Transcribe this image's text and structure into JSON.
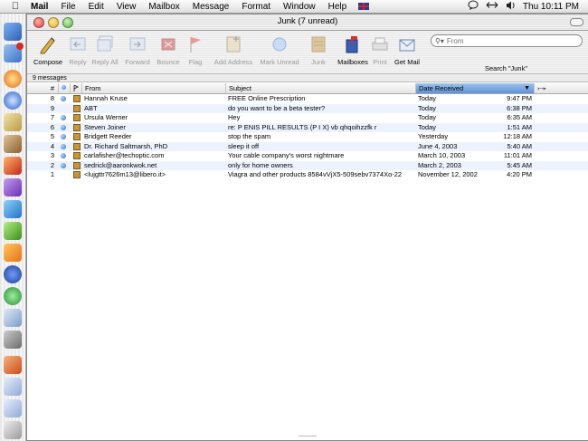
{
  "menubar": {
    "app_name": "Mail",
    "menus": [
      "File",
      "Edit",
      "View",
      "Mailbox",
      "Message",
      "Format",
      "Window",
      "Help"
    ],
    "clock": "Thu 10:11 PM"
  },
  "window": {
    "title": "Junk (7 unread)"
  },
  "toolbar": {
    "buttons": [
      {
        "label": "Compose",
        "enabled": true,
        "icon": "compose-icon"
      },
      {
        "label": "Reply",
        "enabled": false,
        "icon": "reply-icon"
      },
      {
        "label": "Reply All",
        "enabled": false,
        "icon": "reply-all-icon"
      },
      {
        "label": "Forward",
        "enabled": false,
        "icon": "forward-icon"
      },
      {
        "label": "Bounce",
        "enabled": false,
        "icon": "bounce-icon"
      },
      {
        "label": "Flag",
        "enabled": false,
        "icon": "flag-icon"
      },
      {
        "label": "Add Address",
        "enabled": false,
        "icon": "add-address-icon"
      },
      {
        "label": "Mark Unread",
        "enabled": false,
        "icon": "mark-unread-icon"
      },
      {
        "label": "Junk",
        "enabled": false,
        "icon": "junk-icon"
      },
      {
        "label": "Mailboxes",
        "enabled": true,
        "icon": "mailboxes-icon"
      },
      {
        "label": "Print",
        "enabled": false,
        "icon": "print-icon"
      },
      {
        "label": "Get Mail",
        "enabled": true,
        "icon": "get-mail-icon"
      }
    ],
    "search_placeholder": "From",
    "search_label": "Search \"Junk\""
  },
  "message_count": "9 messages",
  "columns": {
    "number": "#",
    "from": "From",
    "subject": "Subject",
    "date": "Date Received"
  },
  "messages": [
    {
      "num": "8",
      "unread": true,
      "from": "Hannah Kruse",
      "subject": "FREE Online Prescription",
      "date": "Today",
      "time": "9:47 PM"
    },
    {
      "num": "9",
      "unread": false,
      "from": "ABT",
      "subject": "do you want to be a beta tester?",
      "date": "Today",
      "time": "6:38 PM"
    },
    {
      "num": "7",
      "unread": true,
      "from": "Ursula Werner",
      "subject": "Hey",
      "date": "Today",
      "time": "6:35 AM"
    },
    {
      "num": "6",
      "unread": true,
      "from": "Steven Joiner",
      "subject": "re: P ENIS PILL RESULTS (P I X) vb qhqoihzzfk r",
      "date": "Today",
      "time": "1:51 AM"
    },
    {
      "num": "5",
      "unread": true,
      "from": "Bridgett Reeder",
      "subject": "stop the spam",
      "date": "Yesterday",
      "time": "12:18 AM"
    },
    {
      "num": "4",
      "unread": true,
      "from": "Dr. Richard Saltmarsh, PhD",
      "subject": "sleep it off",
      "date": "June 4, 2003",
      "time": "5:40 AM"
    },
    {
      "num": "3",
      "unread": true,
      "from": "carlafisher@techoptic.com",
      "subject": "Your cable company's worst nightmare",
      "date": "March 10, 2003",
      "time": "11:01 AM"
    },
    {
      "num": "2",
      "unread": true,
      "from": "sedrick@aaronkwok.net",
      "subject": "only for home owners",
      "date": "March 2, 2003",
      "time": "5:45 AM"
    },
    {
      "num": "1",
      "unread": false,
      "from": "<lujgttr7626m13@libero.it>",
      "subject": "Viagra and other products 8584vVjX5-509sebv7374Xo-22",
      "date": "November 12, 2002",
      "time": "4:20 PM"
    }
  ],
  "colors": {
    "selection_header": "#5d91d5",
    "row_stripe": "#edf3fe",
    "unread_dot": "#2a6fd4",
    "close_light": "#e0443a",
    "minimize_light": "#e9b627",
    "zoom_light": "#5bb841"
  }
}
